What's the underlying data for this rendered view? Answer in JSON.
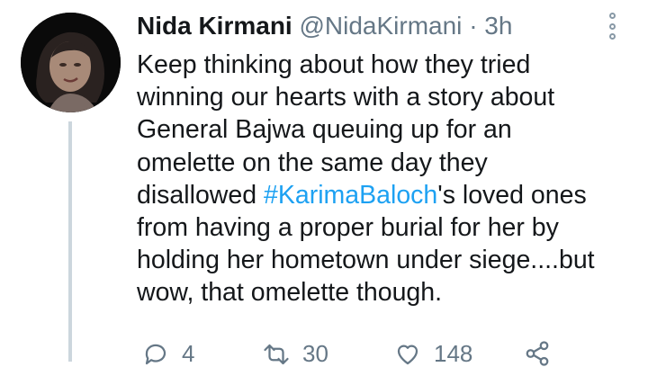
{
  "tweet": {
    "author_name": "Nida Kirmani",
    "handle": "@NidaKirmani",
    "separator": "·",
    "time": "3h",
    "lines": [
      "Keep thinking about how they tried",
      "winning our hearts with a story about",
      "General Bajwa queuing up for an",
      "omelette on the same day they"
    ],
    "line5_prefix": "disallowed ",
    "hashtag": "#KarimaBaloch",
    "line5_suffix": "'s loved ones",
    "lines_after": [
      "from having a proper burial for her by",
      "holding her hometown under siege....but",
      "wow, that omelette though."
    ],
    "reply_count": "4",
    "retweet_count": "30",
    "like_count": "148"
  },
  "icons": {
    "more": "more-options-icon",
    "reply": "reply-icon",
    "retweet": "retweet-icon",
    "like": "heart-icon",
    "share": "share-icon"
  },
  "colors": {
    "hashtag": "#1da1f2",
    "secondary_text": "#657786",
    "thread_line": "#ccd6dd"
  }
}
